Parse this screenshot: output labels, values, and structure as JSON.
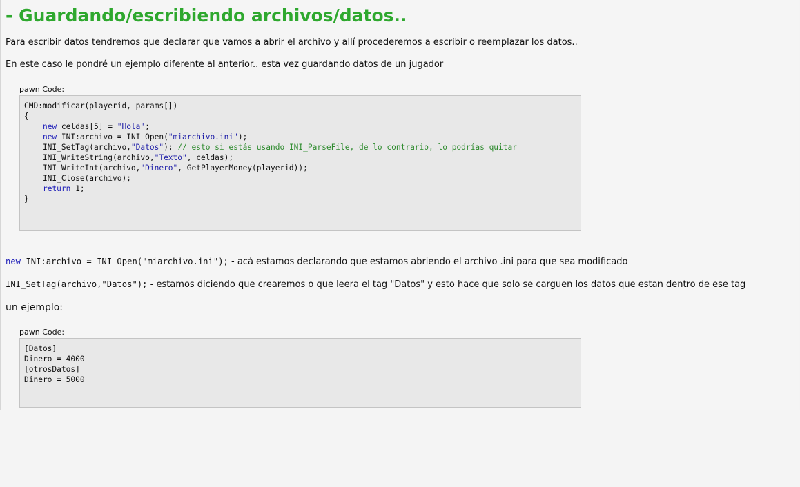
{
  "title": "- Guardando/escribiendo archivos/datos..",
  "paragraphs": {
    "intro": "Para escribir datos tendremos que declarar que vamos a abrir el archivo y allí procederemos a escribir o reemplazar los datos..",
    "case": "En este caso le pondré un ejemplo diferente al anterior.. esta vez guardando datos de un jugador",
    "example": "un ejemplo:"
  },
  "code_blocks": [
    {
      "label": "pawn Code:",
      "lines": [
        [
          {
            "t": "CMD:modificar(playerid, params[])"
          }
        ],
        [
          {
            "t": "{"
          }
        ],
        [
          {
            "t": "    "
          },
          {
            "t": "new",
            "c": "kw"
          },
          {
            "t": " celdas[5] = "
          },
          {
            "t": "\"Hola\"",
            "c": "str"
          },
          {
            "t": ";"
          }
        ],
        [
          {
            "t": "    "
          },
          {
            "t": "new",
            "c": "kw"
          },
          {
            "t": " INI:archivo = INI_Open("
          },
          {
            "t": "\"miarchivo.ini\"",
            "c": "str"
          },
          {
            "t": ");"
          }
        ],
        [
          {
            "t": "    INI_SetTag(archivo,"
          },
          {
            "t": "\"Datos\"",
            "c": "str"
          },
          {
            "t": "); "
          },
          {
            "t": "// esto si estás usando INI_ParseFile, de lo contrario, lo podrías quitar",
            "c": "cm"
          }
        ],
        [
          {
            "t": "    INI_WriteString(archivo,"
          },
          {
            "t": "\"Texto\"",
            "c": "str"
          },
          {
            "t": ", celdas);"
          }
        ],
        [
          {
            "t": "    INI_WriteInt(archivo,"
          },
          {
            "t": "\"Dinero\"",
            "c": "str"
          },
          {
            "t": ", GetPlayerMoney(playerid));"
          }
        ],
        [
          {
            "t": "    INI_Close(archivo);"
          }
        ],
        [
          {
            "t": "    "
          },
          {
            "t": "return",
            "c": "kw"
          },
          {
            "t": " 1;"
          }
        ],
        [
          {
            "t": "}"
          }
        ]
      ]
    },
    {
      "label": "pawn Code:",
      "lines": [
        [
          {
            "t": "[Datos]"
          }
        ],
        [
          {
            "t": "Dinero = 4000"
          }
        ],
        [
          {
            "t": "[otrosDatos]"
          }
        ],
        [
          {
            "t": "Dinero = 5000"
          }
        ]
      ]
    }
  ],
  "explanations": [
    {
      "code": [
        {
          "t": "new",
          "c": "kw"
        },
        {
          "t": " INI:archivo = INI_Open("
        },
        {
          "t": "\"miarchivo.ini\""
        },
        {
          "t": ");"
        }
      ],
      "text": " - acá estamos declarando que estamos abriendo el archivo .ini para que sea modificado"
    },
    {
      "code": [
        {
          "t": "INI_SetTag(archivo,"
        },
        {
          "t": "\"Datos\""
        },
        {
          "t": ");"
        }
      ],
      "text": " - estamos diciendo que crearemos o que leera el tag \"Datos\" y esto hace que solo se carguen los datos que estan dentro de ese tag"
    }
  ],
  "colors": {
    "title": "#2ea82e",
    "keyword": "#1d1db8",
    "comment": "#2e8b2e"
  }
}
